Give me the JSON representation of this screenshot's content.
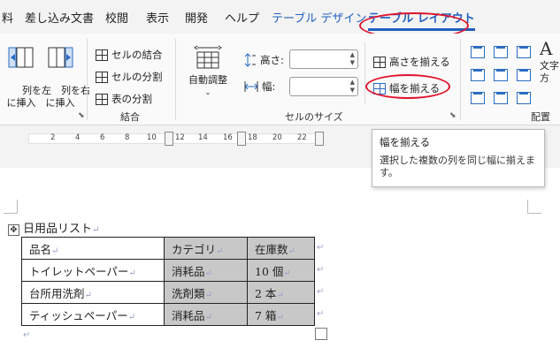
{
  "tabs": [
    {
      "label": "料",
      "type": "normal"
    },
    {
      "label": "差し込み文書",
      "type": "normal"
    },
    {
      "label": "校閲",
      "type": "normal"
    },
    {
      "label": "表示",
      "type": "normal"
    },
    {
      "label": "開発",
      "type": "normal"
    },
    {
      "label": "ヘルプ",
      "type": "normal"
    },
    {
      "label": "テーブル デザイン",
      "type": "contextual"
    },
    {
      "label": "テーブル レイアウト",
      "type": "active"
    }
  ],
  "ribbon": {
    "insert_left": "列を左\nに挿入",
    "insert_right": "列を右\nに挿入",
    "merge_cells": "セルの結合",
    "split_cells": "セルの分割",
    "split_table": "表の分割",
    "merge_group": "結合",
    "autofit": "自動調整",
    "height_label": "高さ:",
    "width_label": "幅:",
    "height_value": "",
    "width_value": "",
    "distribute_rows": "高さを揃える",
    "distribute_cols": "幅を揃える",
    "cell_size_group": "セルのサイズ",
    "text_direction": "文字",
    "text_direction_2": "方",
    "align_group": "配置",
    "font_glyph": "A"
  },
  "ruler": {
    "numbers": [
      "2",
      "4",
      "6",
      "8",
      "10",
      "12",
      "14",
      "16",
      "18",
      "20",
      "22"
    ]
  },
  "tooltip": {
    "title": "幅を揃える",
    "body": "選択した複数の列を同じ幅に揃えます。"
  },
  "document": {
    "title": "日用品リスト",
    "table": {
      "rows": [
        [
          "品名",
          "カテゴリ",
          "在庫数"
        ],
        [
          "トイレットペーパー",
          "消耗品",
          "10 個"
        ],
        [
          "台所用洗剤",
          "洗剤類",
          "2 本"
        ],
        [
          "ティッシュペーパー",
          "消耗品",
          "7 箱"
        ]
      ]
    },
    "para_mark": "↵"
  }
}
